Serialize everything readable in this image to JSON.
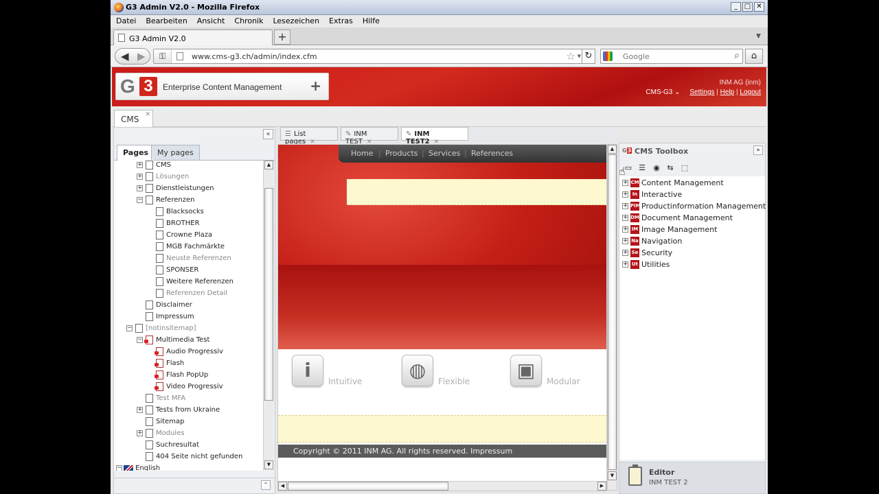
{
  "browser": {
    "window_title": "G3 Admin V2.0 - Mozilla Firefox",
    "menu": [
      "Datei",
      "Bearbeiten",
      "Ansicht",
      "Chronik",
      "Lesezeichen",
      "Extras",
      "Hilfe"
    ],
    "tab_title": "G3 Admin V2.0",
    "url": "www.cms-g3.ch/admin/index.cfm",
    "search_placeholder": "Google"
  },
  "header": {
    "logo_text": "G3",
    "tagline": "Enterprise Content Management",
    "user": "INM AG (inm)",
    "site_select": "CMS-G3",
    "settings": "Settings",
    "help": "Help",
    "logout": "Logout"
  },
  "app_tab": "CMS",
  "left_panel": {
    "tabs": [
      "Pages",
      "My pages"
    ],
    "tree": [
      {
        "label": "CMS"
      },
      {
        "label": "Lösungen"
      },
      {
        "label": "Dienstleistungen"
      },
      {
        "label": "Referenzen"
      },
      {
        "label": "Blacksocks"
      },
      {
        "label": "BROTHER"
      },
      {
        "label": "Crowne Plaza"
      },
      {
        "label": "MGB Fachmärkte"
      },
      {
        "label": "Neuste Referenzen"
      },
      {
        "label": "SPONSER"
      },
      {
        "label": "Weitere Referenzen"
      },
      {
        "label": "Referenzen Detail"
      },
      {
        "label": "Disclaimer"
      },
      {
        "label": "Impressum"
      },
      {
        "label": "[notinsitemap]"
      },
      {
        "label": "Multimedia Test"
      },
      {
        "label": "Audio Progressiv"
      },
      {
        "label": "Flash"
      },
      {
        "label": "Flash PopUp"
      },
      {
        "label": "Video Progressiv"
      },
      {
        "label": "Test MFA"
      },
      {
        "label": "Tests from Ukraine"
      },
      {
        "label": "Sitemap"
      },
      {
        "label": "Modules"
      },
      {
        "label": "Suchresultat"
      },
      {
        "label": "404 Seite nicht gefunden"
      },
      {
        "label": "English"
      }
    ]
  },
  "doc_tabs": [
    "List pages",
    "INM TEST",
    "INM TEST2"
  ],
  "preview": {
    "nav": [
      "Home",
      "Products",
      "Services",
      "References"
    ],
    "features": [
      "Intuitive",
      "Flexible",
      "Modular"
    ],
    "footer": "Copyright © 2011 INM AG. All rights reserved.   Impressum"
  },
  "toolbox": {
    "title": "CMS Toolbox",
    "items": [
      {
        "badge": "CM",
        "label": "Content Management"
      },
      {
        "badge": "In",
        "label": "Interactive"
      },
      {
        "badge": "PIM",
        "label": "Productinformation Management"
      },
      {
        "badge": "DM",
        "label": "Document Management"
      },
      {
        "badge": "IM",
        "label": "Image Management"
      },
      {
        "badge": "Na",
        "label": "Navigation"
      },
      {
        "badge": "Se",
        "label": "Security"
      },
      {
        "badge": "Ut",
        "label": "Utilities"
      }
    ],
    "editor_label": "Editor",
    "editor_doc": "INM TEST 2"
  },
  "colors": {
    "brand_red": "#c81a1a",
    "highlight_yellow": "#fdf8cf"
  }
}
